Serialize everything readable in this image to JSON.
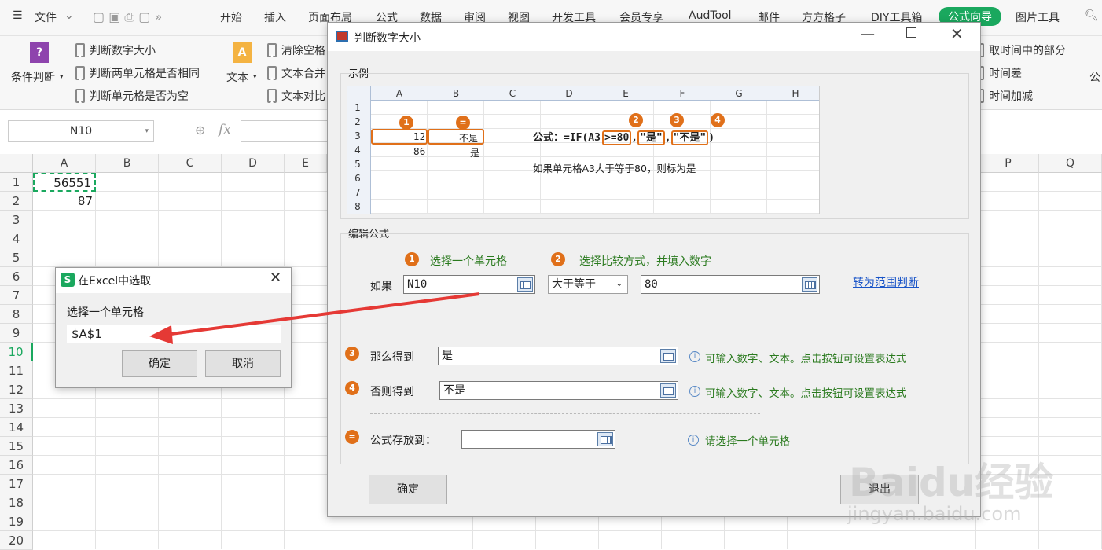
{
  "tabs": {
    "file": "文件",
    "items": [
      "开始",
      "插入",
      "页面布局",
      "公式",
      "数据",
      "审阅",
      "视图",
      "开发工具",
      "会员专享",
      "AudTool",
      "邮件",
      "方方格子",
      "DIY工具箱",
      "公式向导",
      "图片工具"
    ]
  },
  "ribbon": {
    "cond": "条件判断",
    "b1": "判断数字大小",
    "b2": "判断两单元格是否相同",
    "b3": "判断单元格是否为空",
    "text": "文本",
    "c1": "清除空格",
    "c2": "文本合并",
    "c3": "文本对比",
    "r1": "取时间中的部分",
    "r2": "时间差",
    "r3": "时间加减",
    "r4": "公"
  },
  "namebox": "N10",
  "fx": "fx",
  "cols": [
    "A",
    "B",
    "C",
    "D",
    "E",
    "P",
    "Q"
  ],
  "rows": [
    "1",
    "2",
    "3",
    "4",
    "5",
    "6",
    "7",
    "8",
    "9",
    "10",
    "11",
    "12",
    "13",
    "14",
    "15",
    "16",
    "17",
    "18",
    "19",
    "20"
  ],
  "cells": {
    "a1": "56551",
    "a2": "87"
  },
  "main": {
    "title": "判断数字大小",
    "example_label": "示例",
    "ex_cols": [
      "A",
      "B",
      "C",
      "D",
      "E",
      "F",
      "G",
      "H"
    ],
    "ex_rows": [
      "1",
      "2",
      "3",
      "4",
      "5",
      "6",
      "7",
      "8"
    ],
    "ex_a3": "12",
    "ex_b3": "不是",
    "ex_a4": "86",
    "ex_b4": "是",
    "ex_formula_a": "公式：=IF(A3",
    "ex_formula_b": ">=80",
    "ex_formula_c": ",",
    "ex_formula_d": "\"是\"",
    "ex_formula_e": ",",
    "ex_formula_f": "\"不是\"",
    "ex_formula_g": ")",
    "ex_note": "如果单元格A3大于等于80，则标为是",
    "edit_label": "编辑公式",
    "step1": "选择一个单元格",
    "step2": "选择比较方式，并填入数字",
    "if_label": "如果",
    "if_value": "N10",
    "op_value": "大于等于",
    "num_value": "80",
    "range_link": "转为范围判断",
    "then_label": "那么得到",
    "then_value": "是",
    "hint": "可输入数字、文本。点击按钮可设置表达式",
    "else_label": "否则得到",
    "else_value": "不是",
    "store_label": "公式存放到：",
    "store_hint": "请选择一个单元格",
    "ok": "确定",
    "exit": "退出",
    "badge_eq": "="
  },
  "picker": {
    "title": "在Excel中选取",
    "label": "选择一个单元格",
    "value": "$A$1",
    "ok": "确定",
    "cancel": "取消",
    "icon": "S"
  },
  "watermark": {
    "logo": "Baidu经验",
    "url": "jingyan.baidu.com"
  },
  "colors": {
    "accent": "#1aa85e",
    "orange": "#e0701a",
    "arrow": "#e53935"
  }
}
